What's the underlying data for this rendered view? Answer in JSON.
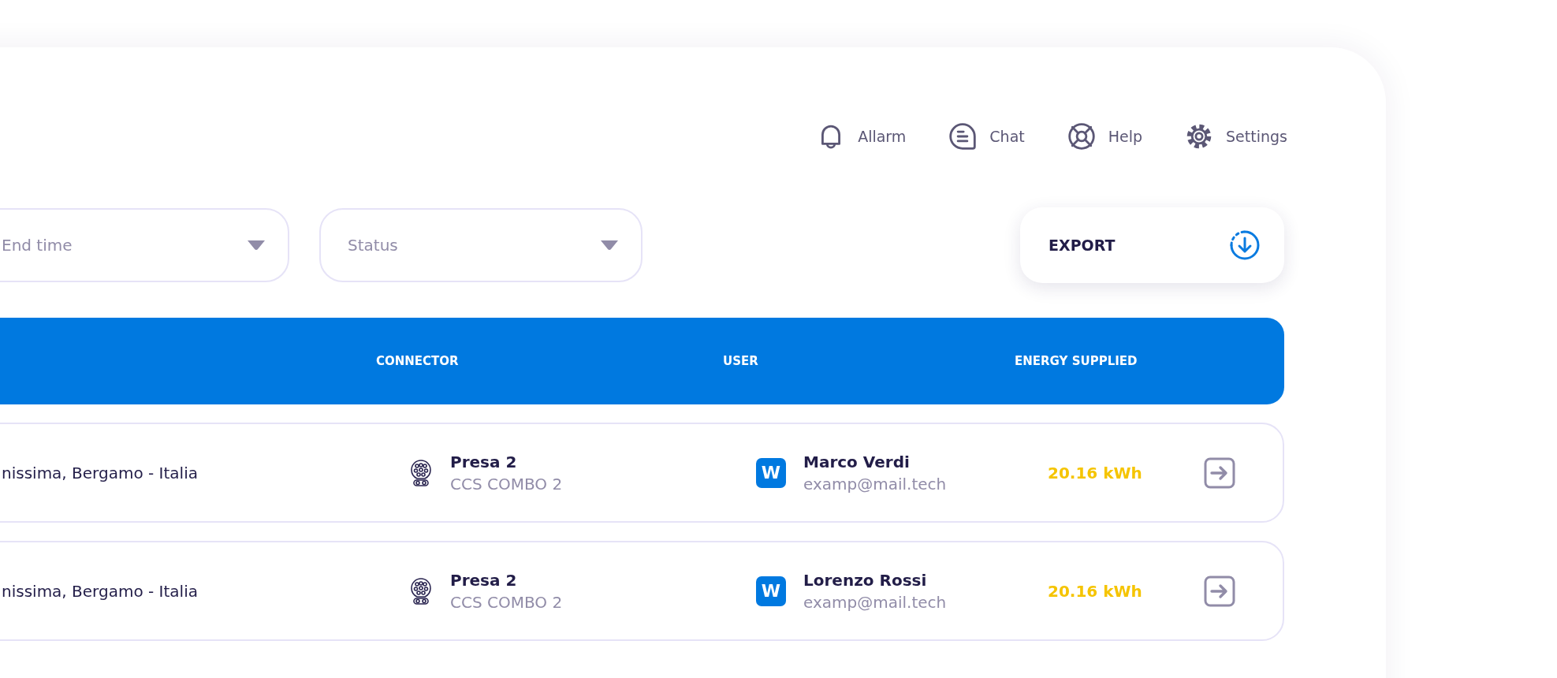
{
  "toolbar": {
    "items": [
      {
        "kind": "bell",
        "label": "Allarm"
      },
      {
        "kind": "chat",
        "label": "Chat"
      },
      {
        "kind": "help",
        "label": "Help"
      },
      {
        "kind": "settings",
        "label": "Settings"
      }
    ]
  },
  "filters": [
    {
      "placeholder": "End time"
    },
    {
      "placeholder": "Status"
    }
  ],
  "export_button": {
    "label": "EXPORT"
  },
  "table": {
    "columns": [
      "CONNECTOR",
      "USER",
      "ENERGY SUPPLIED"
    ],
    "rows": [
      {
        "location": "nissima, Bergamo - Italia",
        "connector": {
          "name": "Presa 2",
          "type": "CCS COMBO 2"
        },
        "user": {
          "initial": "W",
          "name": "Marco Verdi",
          "email": "examp@mail.tech"
        },
        "energy": "20.16 kWh"
      },
      {
        "location": "nissima, Bergamo - Italia",
        "connector": {
          "name": "Presa 2",
          "type": "CCS COMBO 2"
        },
        "user": {
          "initial": "W",
          "name": "Lorenzo Rossi",
          "email": "examp@mail.tech"
        },
        "energy": "20.16 kWh"
      }
    ]
  }
}
